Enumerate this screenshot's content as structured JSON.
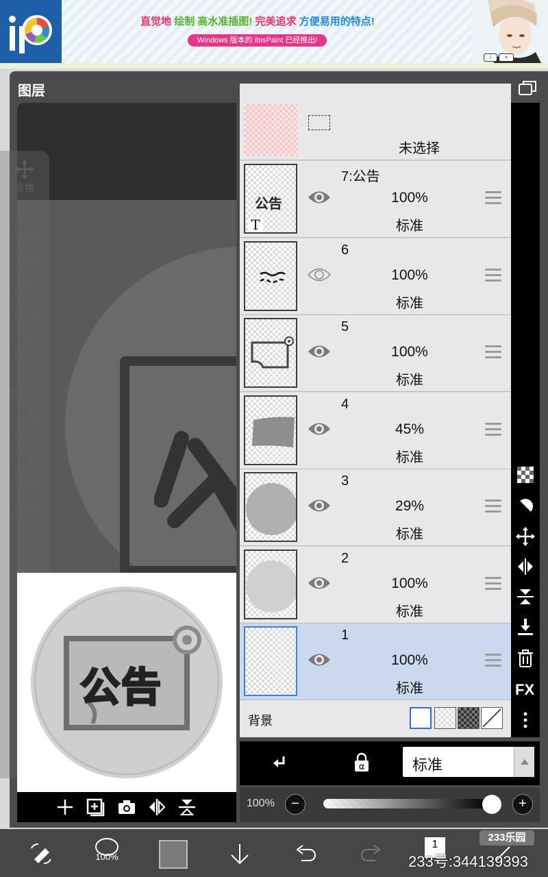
{
  "banner": {
    "line1_a": "直觉地",
    "line1_b": "绘制",
    "line1_c": "高水准插图!",
    "line1_d": "完美追求",
    "line1_e": "方便易用的特点!",
    "line2": "Windows 版本的 ibisPaint 已经推出!"
  },
  "panel": {
    "title": "图层"
  },
  "tools": [
    {
      "label": "变换",
      "icon": "move-icon"
    },
    {
      "label": "魔棒",
      "icon": "magic-wand-icon"
    },
    {
      "label": "套索",
      "icon": "lasso-icon"
    },
    {
      "label": "滤镜",
      "icon": "fx-icon"
    },
    {
      "label": "画笔",
      "icon": "brush-icon"
    },
    {
      "label": "橡皮擦",
      "icon": "eraser-icon"
    },
    {
      "label": "涂抹",
      "icon": "smudge-icon"
    },
    {
      "label": "模糊",
      "icon": "blur-icon"
    },
    {
      "label": "油漆桶",
      "icon": "bucket-icon"
    }
  ],
  "preview": {
    "text": "公告"
  },
  "selection_layer": {
    "label": "未选择"
  },
  "layers": [
    {
      "name": "7:公告",
      "opacity": "100%",
      "blend": "标准",
      "visible": true,
      "thumb": "text"
    },
    {
      "name": "6",
      "opacity": "100%",
      "blend": "标准",
      "visible": false,
      "thumb": "squiggle"
    },
    {
      "name": "5",
      "opacity": "100%",
      "blend": "标准",
      "visible": true,
      "thumb": "frame"
    },
    {
      "name": "4",
      "opacity": "45%",
      "blend": "标准",
      "visible": true,
      "thumb": "rect"
    },
    {
      "name": "3",
      "opacity": "29%",
      "blend": "标准",
      "visible": true,
      "thumb": "circle-dark"
    },
    {
      "name": "2",
      "opacity": "100%",
      "blend": "标准",
      "visible": true,
      "thumb": "circle-light"
    },
    {
      "name": "1",
      "opacity": "100%",
      "blend": "标准",
      "visible": true,
      "thumb": "empty"
    }
  ],
  "background": {
    "label": "背景"
  },
  "blend_mode": {
    "value": "标准"
  },
  "opacity": {
    "label": "100%",
    "value": 1.0
  },
  "watermark": {
    "badge": "233乐园",
    "id": "233号:344139393"
  },
  "bottom": {
    "brush_size": "100%",
    "layer_count": "1"
  }
}
